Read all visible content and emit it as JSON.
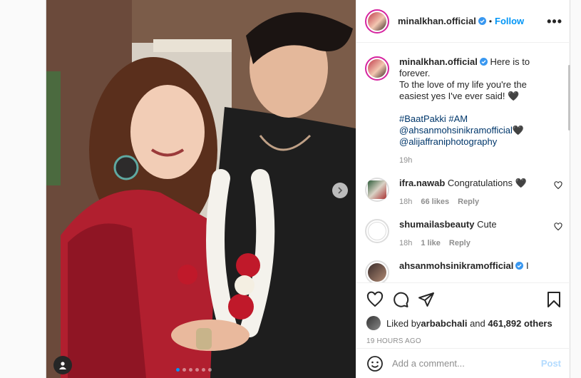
{
  "header": {
    "username": "minalkhan.official",
    "separator": "•",
    "follow_label": "Follow",
    "more_label": "•••"
  },
  "caption": {
    "username": "minalkhan.official",
    "line1": "Here is to forever.",
    "line2": "To the love of my life you're the easiest yes I've ever said! 🖤",
    "hashtags": "#BaatPakki #AM",
    "mention1": "@ahsanmohsinikramofficial🖤",
    "mention2": "@alijaffraniphotography",
    "age": "19h"
  },
  "comments": [
    {
      "username": "ifra.nawab",
      "text": "Congratulations 🖤",
      "age": "18h",
      "likes": "66 likes",
      "reply": "Reply"
    },
    {
      "username": "shumailasbeauty",
      "text": "Cute",
      "age": "18h",
      "likes": "1 like",
      "reply": "Reply"
    },
    {
      "username": "ahsanmohsinikramofficial",
      "text": "I",
      "age": "",
      "likes": "",
      "reply": ""
    }
  ],
  "likes": {
    "prefix": "Liked by ",
    "user": "arbabchali",
    "middle": " and ",
    "others": "461,892 others"
  },
  "timestamp": "19 HOURS AGO",
  "add_comment": {
    "placeholder": "Add a comment...",
    "post_label": "Post"
  },
  "carousel": {
    "slides": 6,
    "active_index": 0
  },
  "colors": {
    "accent": "#0095f6",
    "verified": "#3897f0",
    "post_disabled": "#b3dbff"
  },
  "icons": [
    "more-icon",
    "verified-icon",
    "heart-icon",
    "comment-icon",
    "share-icon",
    "bookmark-icon",
    "emoji-icon",
    "chevron-right-icon",
    "user-tag-icon"
  ]
}
